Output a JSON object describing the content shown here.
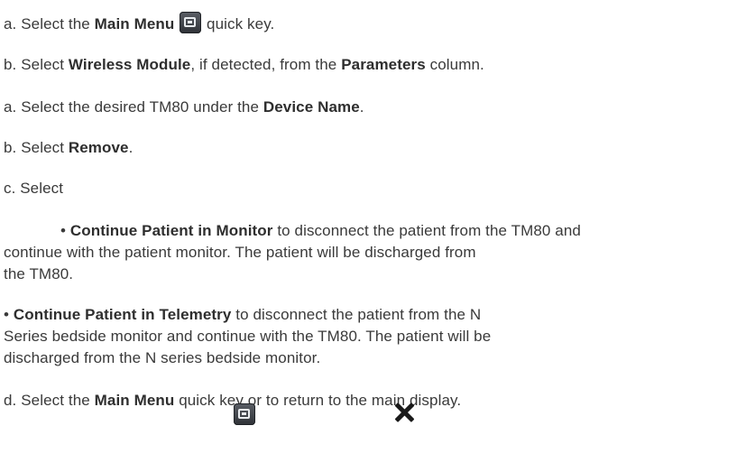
{
  "steps": [
    {
      "prefix": "a. Select the ",
      "bold": "Main Menu",
      "suffix": " quick key."
    },
    {
      "prefix": "b. Select ",
      "bold1": "Wireless Module",
      "middle": ", if detected, from the ",
      "bold2": "Parameters",
      "suffix": " column."
    },
    {
      "prefix": "a. Select the desired TM80 under the ",
      "bold": "Device Name",
      "suffix": "."
    },
    {
      "prefix": "b. Select ",
      "bold": "Remove",
      "suffix": "."
    },
    {
      "text": "c. Select"
    },
    {
      "bullet": "• ",
      "bold": "Continue Patient in Monitor",
      "line1_rest": " to disconnect the patient from the TM80 and",
      "line2": "continue with the patient monitor. The patient will be discharged from",
      "line3": "the TM80."
    },
    {
      "bullet": "• ",
      "bold": "Continue Patient in Telemetry",
      "line1_rest": " to disconnect the patient from the N",
      "line2": "Series bedside monitor and continue with the TM80. The patient will be",
      "line3": "discharged from the N series bedside monitor."
    },
    {
      "prefix": "d. Select the ",
      "bold": "Main Menu",
      "middle": " quick key or to return to the main display."
    }
  ],
  "icons": {
    "main_menu_icon": "main-menu-icon",
    "close_icon": "close-icon"
  }
}
